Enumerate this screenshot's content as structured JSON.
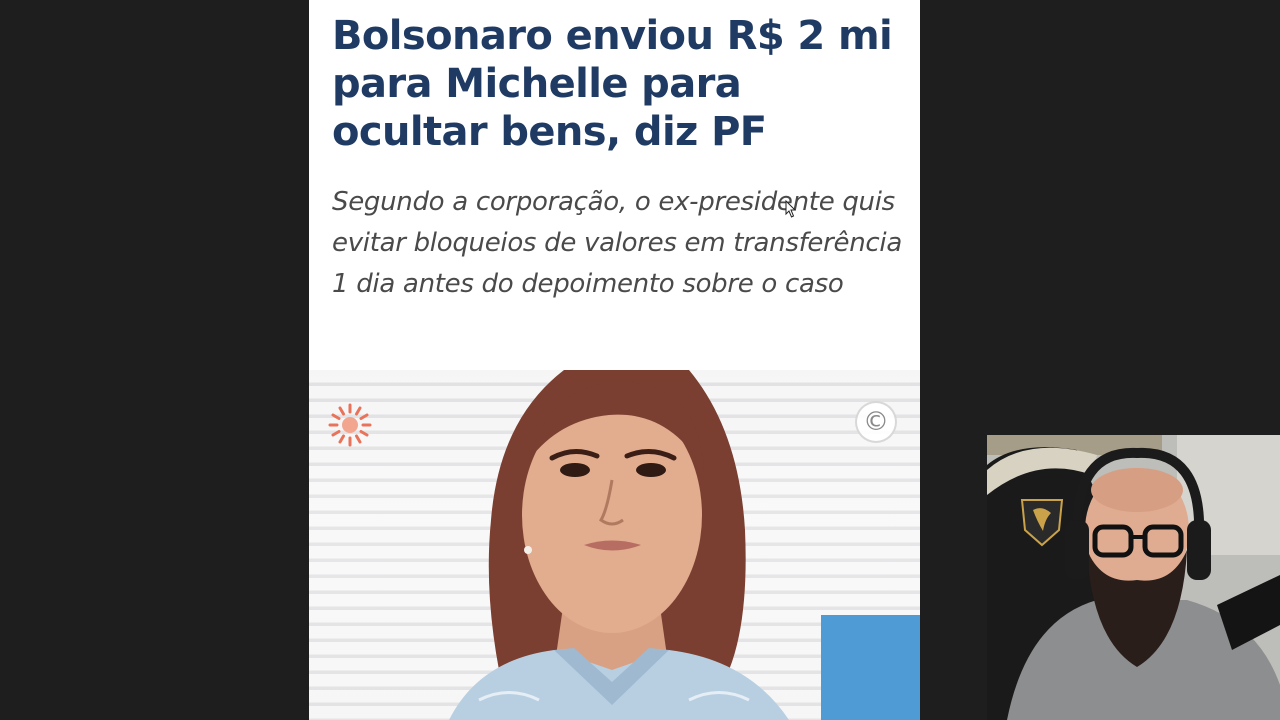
{
  "article": {
    "headline": "Bolsonaro enviou R$ 2 mi para Michelle para ocultar bens, diz PF",
    "subtitle": "Segundo a corporação, o ex-presidente quis evitar bloqueios de valores em transferência 1 dia antes do depoimento sobre o caso"
  },
  "photo": {
    "copyright_symbol": "©",
    "logo_icon": "sun-logo-icon",
    "accent_color": "#e8735a"
  },
  "webcam": {
    "chair_brand_icon": "cougar-logo-icon"
  },
  "colors": {
    "headline": "#1f3b63",
    "subtitle": "#4a4a4a",
    "background": "#1e1e1e"
  }
}
